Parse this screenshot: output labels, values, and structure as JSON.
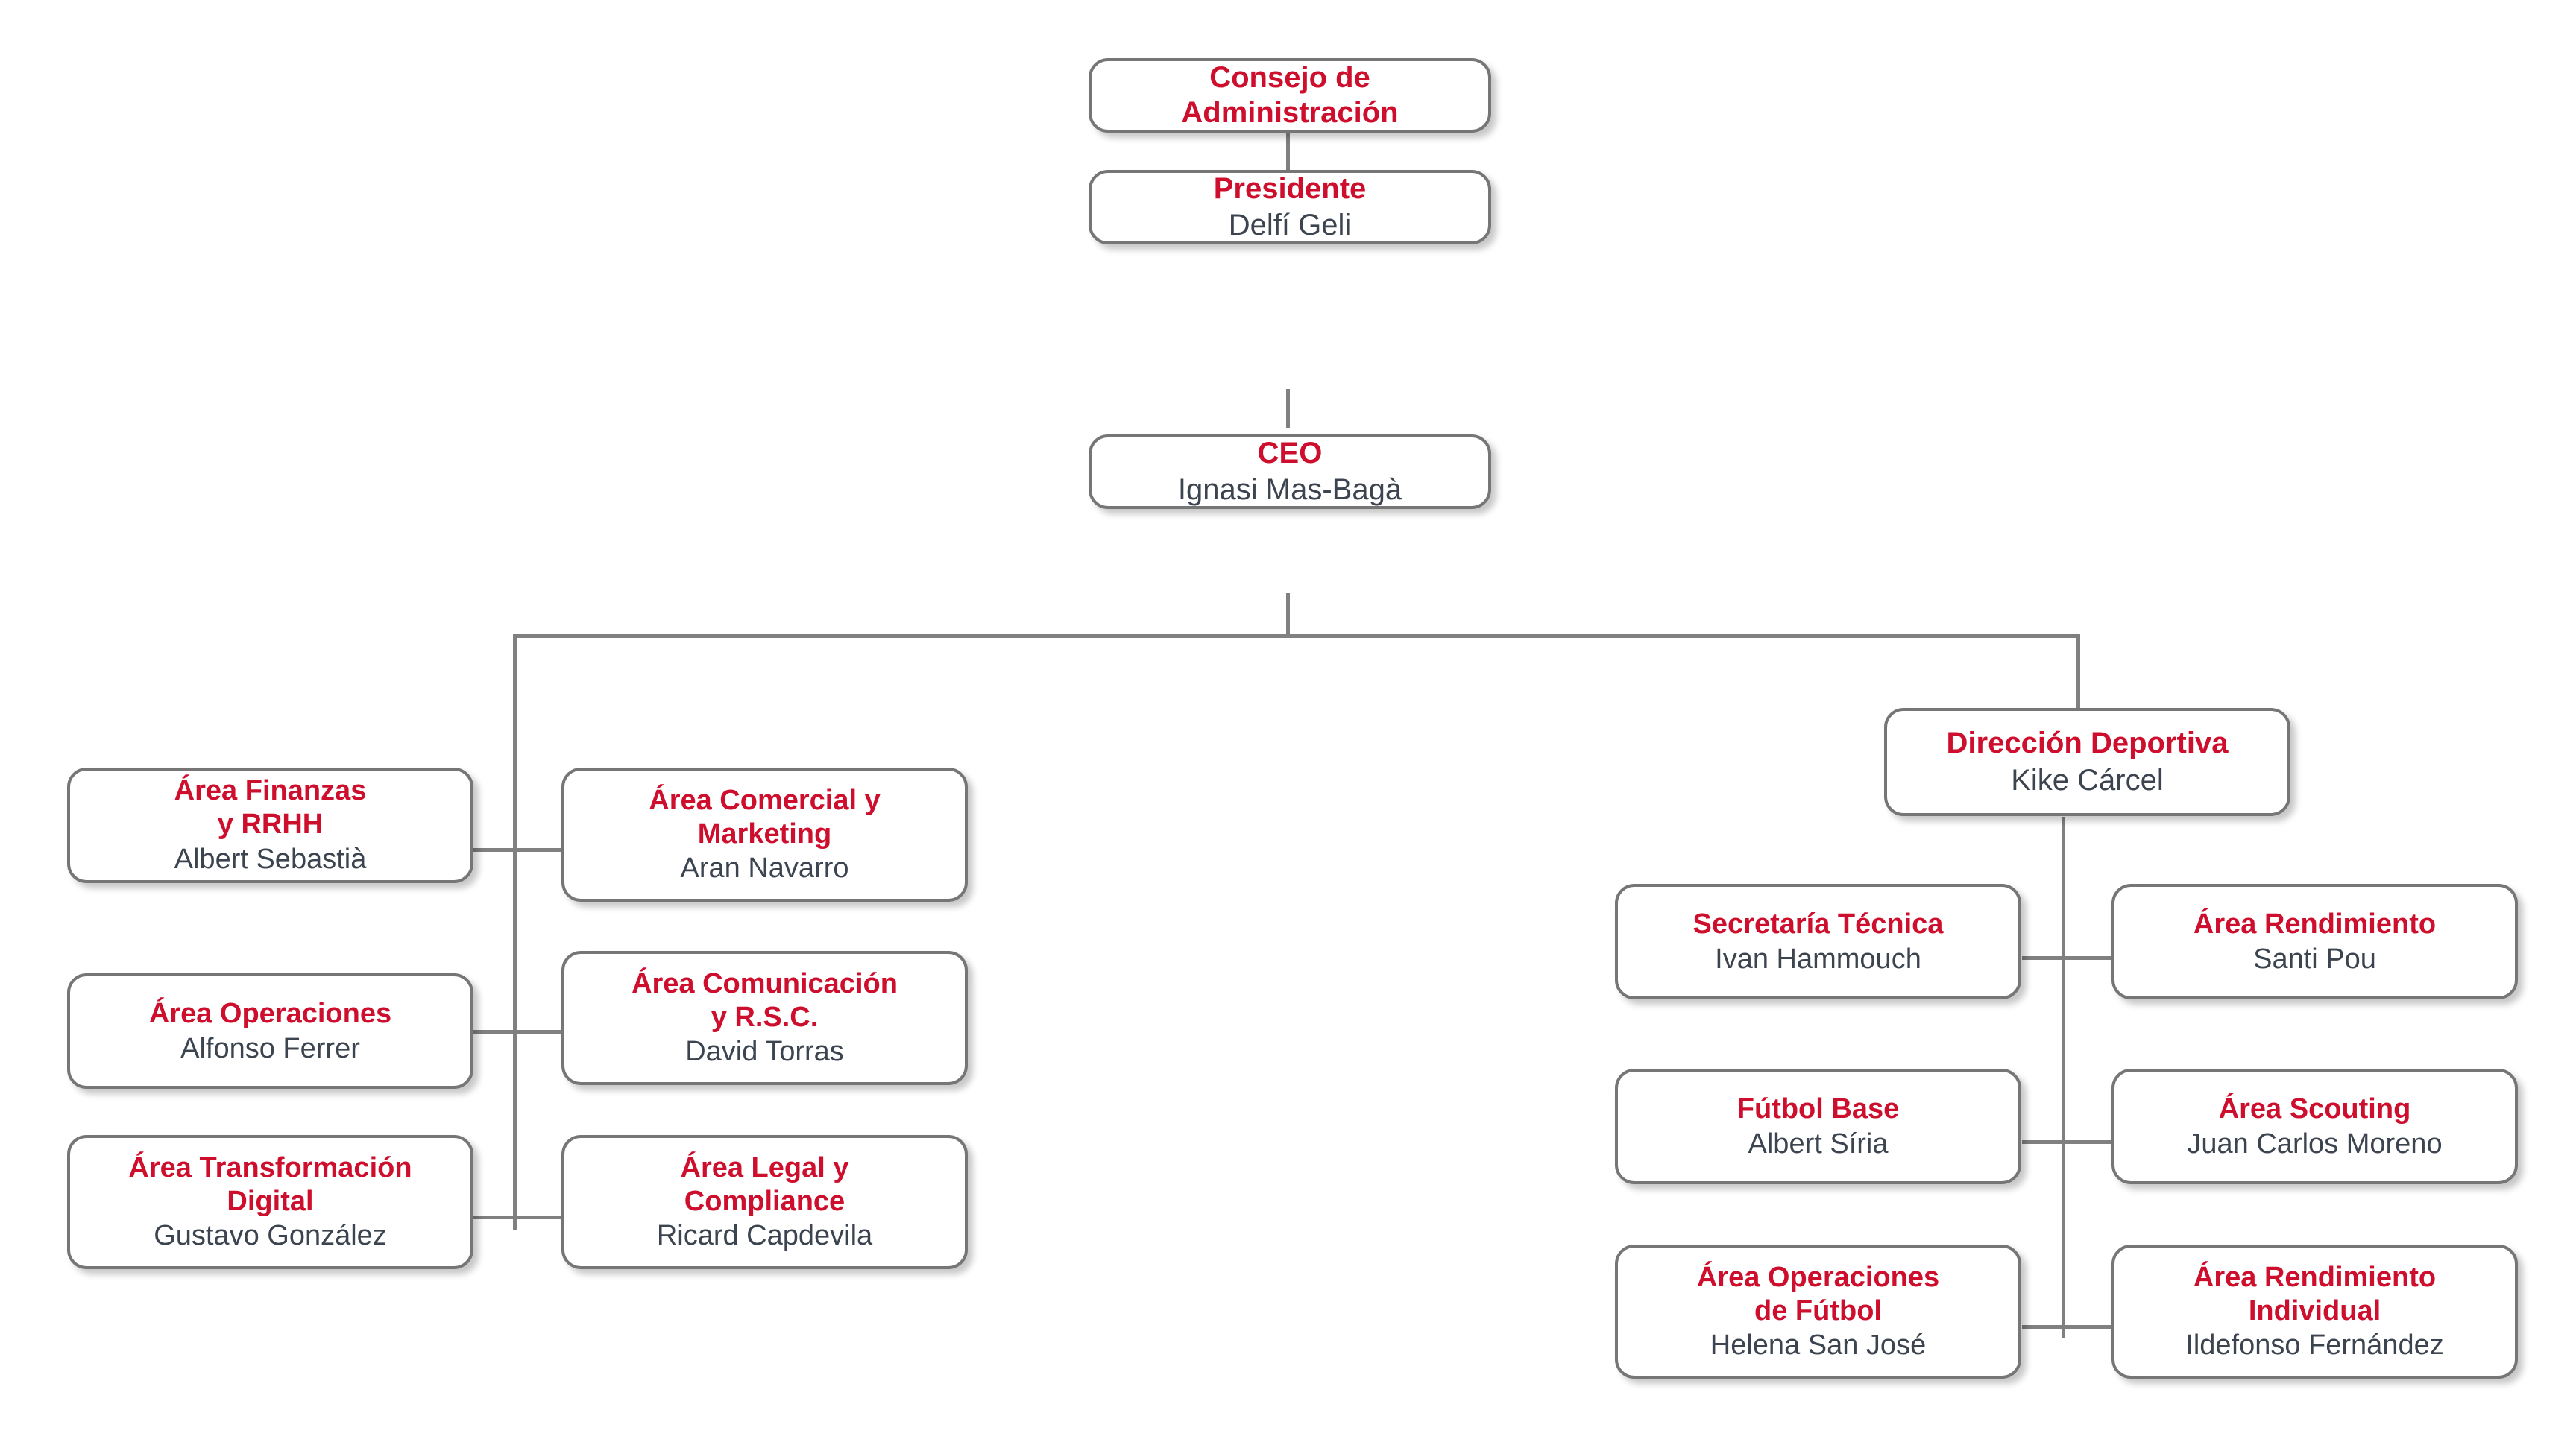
{
  "theme": {
    "title_color": "#CE0E2D",
    "person_color": "#3C4450",
    "border_color": "#767676",
    "connector_color": "#808080",
    "background": "#ffffff"
  },
  "chart": {
    "type": "org-chart",
    "nodes": [
      {
        "id": "consejo",
        "title": "Consejo de\nAdministración",
        "person": ""
      },
      {
        "id": "presidente",
        "title": "Presidente",
        "person": "Delfí Geli"
      },
      {
        "id": "ceo",
        "title": "CEO",
        "person": "Ignasi Mas-Bagà"
      },
      {
        "id": "finanzas",
        "title": "Área Finanzas\ny RRHH",
        "person": "Albert Sebastià"
      },
      {
        "id": "operaciones",
        "title": "Área Operaciones",
        "person": "Alfonso Ferrer"
      },
      {
        "id": "transformacion",
        "title": "Área Transformación\nDigital",
        "person": "Gustavo González"
      },
      {
        "id": "comercial",
        "title": "Área Comercial y\nMarketing",
        "person": "Aran Navarro"
      },
      {
        "id": "comunicacion",
        "title": "Área Comunicación\ny R.S.C.",
        "person": "David Torras"
      },
      {
        "id": "legal",
        "title": "Área Legal y\nCompliance",
        "person": "Ricard Capdevila"
      },
      {
        "id": "deportiva",
        "title": "Dirección Deportiva",
        "person": "Kike Cárcel"
      },
      {
        "id": "secretaria",
        "title": "Secretaría Técnica",
        "person": "Ivan Hammouch"
      },
      {
        "id": "futbolbase",
        "title": "Fútbol Base",
        "person": "Albert Síria"
      },
      {
        "id": "opsfutbol",
        "title": "Área Operaciones\nde Fútbol",
        "person": "Helena San José"
      },
      {
        "id": "rendimiento",
        "title": "Área Rendimiento",
        "person": "Santi Pou"
      },
      {
        "id": "scouting",
        "title": "Área Scouting",
        "person": "Juan Carlos Moreno"
      },
      {
        "id": "rendindiv",
        "title": "Área Rendimiento\nIndividual",
        "person": "Ildefonso Fernández"
      }
    ],
    "edges": [
      {
        "from": "consejo",
        "to": "presidente"
      },
      {
        "from": "presidente",
        "to": "ceo"
      },
      {
        "from": "ceo",
        "to": "finanzas"
      },
      {
        "from": "ceo",
        "to": "operaciones"
      },
      {
        "from": "ceo",
        "to": "transformacion"
      },
      {
        "from": "ceo",
        "to": "comercial"
      },
      {
        "from": "ceo",
        "to": "comunicacion"
      },
      {
        "from": "ceo",
        "to": "legal"
      },
      {
        "from": "ceo",
        "to": "deportiva"
      },
      {
        "from": "deportiva",
        "to": "secretaria"
      },
      {
        "from": "deportiva",
        "to": "futbolbase"
      },
      {
        "from": "deportiva",
        "to": "opsfutbol"
      },
      {
        "from": "deportiva",
        "to": "rendimiento"
      },
      {
        "from": "deportiva",
        "to": "scouting"
      },
      {
        "from": "deportiva",
        "to": "rendindiv"
      }
    ]
  }
}
